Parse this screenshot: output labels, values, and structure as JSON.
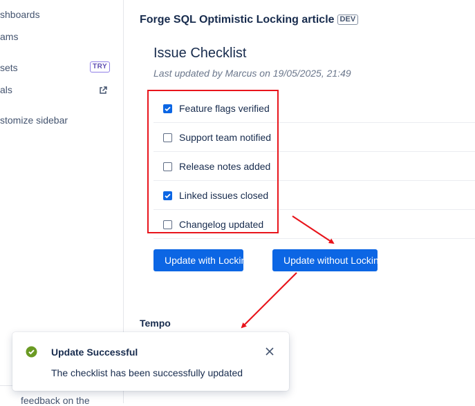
{
  "sidebar": {
    "items": [
      {
        "label": "shboards"
      },
      {
        "label": "ams"
      },
      {
        "label": "sets",
        "badge": "TRY"
      },
      {
        "label": "als",
        "icon": "external-link-icon"
      },
      {
        "label": "stomize sidebar"
      }
    ],
    "footer": "feedback on the"
  },
  "page": {
    "title": "Forge SQL Optimistic Locking article",
    "env_badge": "DEV"
  },
  "checklist": {
    "title": "Issue Checklist",
    "subtitle": "Last updated by Marcus on 19/05/2025, 21:49",
    "items": [
      {
        "label": "Feature flags verified",
        "checked": true
      },
      {
        "label": "Support team notified",
        "checked": false
      },
      {
        "label": "Release notes added",
        "checked": false
      },
      {
        "label": "Linked issues closed",
        "checked": true
      },
      {
        "label": "Changelog updated",
        "checked": false
      }
    ]
  },
  "buttons": {
    "update_with_locking": "Update with Locking",
    "update_without_locking": "Update without Locking"
  },
  "section": {
    "tempo": "Tempo"
  },
  "toast": {
    "title": "Update Successful",
    "message": "The checklist has been successfully updated",
    "icon": "success-check-icon",
    "close_icon": "close-icon"
  },
  "colors": {
    "primary": "#0c66e4",
    "annotation": "#e8141b",
    "success": "#6a9a23",
    "try_badge": "#5e4db2"
  }
}
